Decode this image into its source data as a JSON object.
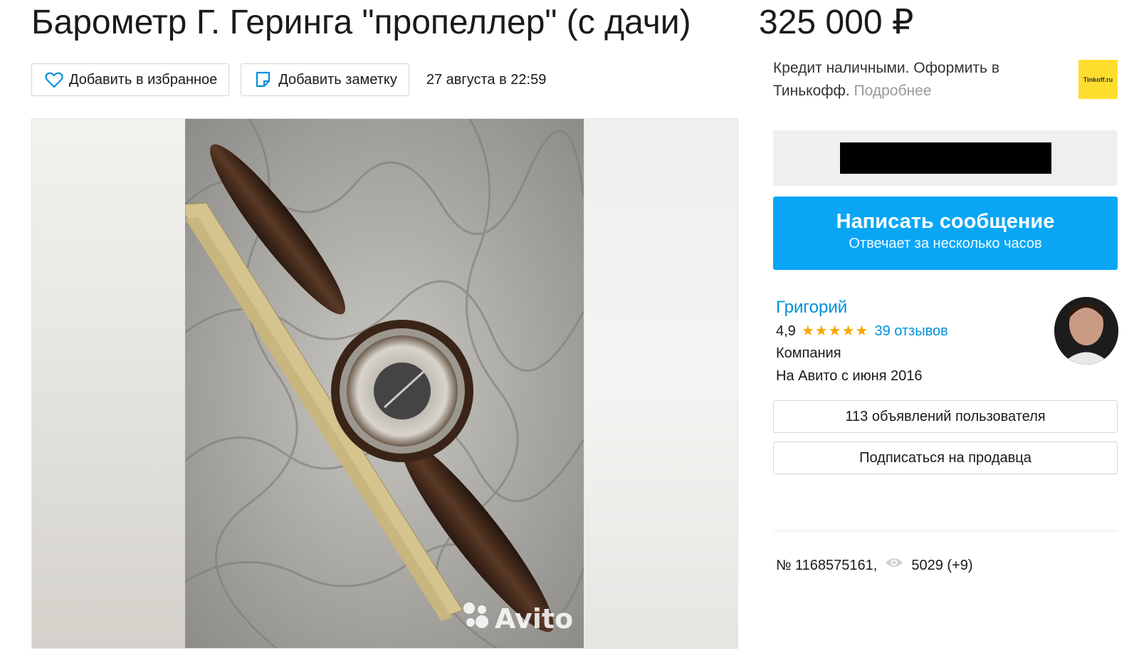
{
  "listing": {
    "title": "Барометр Г. Геринга \"пропеллер\" (с дачи)",
    "price": "325 000 ₽",
    "date": "27 августа в 22:59",
    "number": "№ 1168575161,",
    "views": "5029 (+9)"
  },
  "actions": {
    "favorite_label": "Добавить в избранное",
    "note_label": "Добавить заметку"
  },
  "gallery": {
    "watermark": "Avito"
  },
  "credit": {
    "text": "Кредит наличными. Оформить в Тинькофф.",
    "more_link": "Подробнее",
    "logo_text": "Tinkoff.ru"
  },
  "contact": {
    "message_button": "Написать сообщение",
    "message_sub": "Отвечает за несколько часов"
  },
  "seller": {
    "name": "Григорий",
    "rating": "4,9",
    "stars": 5,
    "reviews": "39 отзывов",
    "type": "Компания",
    "since": "На Авито с июня 2016",
    "listings_button": "113 объявлений пользователя",
    "subscribe_button": "Подписаться на продавца"
  },
  "colors": {
    "accent": "#0aa6f5",
    "link": "#0091d9",
    "star": "#f7a600",
    "tinkoff": "#ffdd2d"
  }
}
